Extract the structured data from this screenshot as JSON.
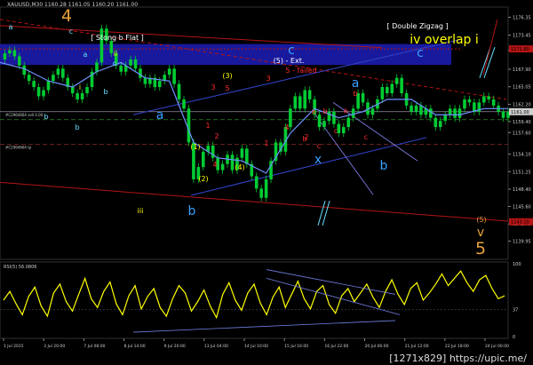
{
  "header": {
    "symbol_line": "XAUUSD,M30  1160.28 1161.05 1160.20 1161.00"
  },
  "watermark": "[1271x829] https://upic.me/",
  "colors": {
    "background": "#000000",
    "candle": "#00cc33",
    "ma_line": "#6f93ff",
    "channel": "#3040c0",
    "red_line": "#b41414",
    "blue_box": "#1a1aa5",
    "price_line": "#9090a0",
    "rsi_line": "#ffff00",
    "wave_orange": "#e8a23a",
    "wave_yellow": "#ffff00",
    "wave_red": "#ff2a2a",
    "wave_blue": "#3aa0ff",
    "wave_cyan": "#66e0ff",
    "white_text": "#ffffff"
  },
  "chart_data": {
    "type": "line",
    "title": "XAUUSD,M30",
    "ylim": [
      1137,
      1178
    ],
    "y_ticks": [
      "1176.35",
      "1173.45",
      "1171.00",
      "1167.90",
      "1165.05",
      "1162.20",
      "1159.40",
      "1157.60",
      "1154.10",
      "1151.25",
      "1148.40",
      "1145.60",
      "1142.75",
      "1139.95"
    ],
    "price_now": "1161.00",
    "price_tags": [
      {
        "text": "1161.00",
        "price": 1161.0,
        "color": "#cfcfcf"
      },
      {
        "text": "1171.80",
        "price": 1171.2,
        "color": "#b41414"
      },
      {
        "text": "1143.10",
        "price": 1143.1,
        "color": "#b41414"
      }
    ],
    "x_tick_labels": [
      "1 Jul 2015",
      "3 Jul 20:00",
      "7 Jul 08:00",
      "8 Jul 14:00",
      "9 Jul 20:00",
      "13 Jul 04:00",
      "14 Jul 10:00",
      "15 Jul 16:00",
      "16 Jul 22:00",
      "20 Jul 06:00",
      "21 Jul 12:00",
      "22 Jul 18:00",
      "24 Jul 00:00"
    ],
    "series": [
      {
        "name": "price",
        "x": [
          0,
          4,
          8,
          12,
          16,
          20,
          24,
          28,
          32,
          36,
          40,
          44,
          48,
          52,
          56,
          60,
          64,
          68,
          72,
          76,
          80,
          84,
          88,
          92,
          96,
          100,
          104,
          108,
          112,
          116,
          120,
          124,
          128,
          132,
          136,
          140,
          144,
          148,
          152,
          156,
          160,
          164,
          168,
          172,
          176,
          180,
          184,
          188,
          192,
          196,
          200,
          204,
          208,
          212,
          216,
          220,
          224,
          228,
          232,
          236,
          240,
          244,
          248,
          252,
          256,
          260,
          264,
          268,
          272,
          276,
          280,
          284,
          288,
          292,
          296,
          300,
          304,
          308,
          312,
          316,
          320,
          324,
          328,
          332,
          336,
          340,
          344,
          348,
          352,
          356,
          360,
          364,
          368,
          372,
          376,
          380,
          384,
          388,
          392,
          396,
          400,
          404,
          408,
          412,
          416,
          420
        ],
        "values": [
          1169.5,
          1170.5,
          1171.0,
          1170.0,
          1168.5,
          1167.0,
          1166.0,
          1165.0,
          1163.5,
          1164.5,
          1166.0,
          1167.0,
          1168.0,
          1166.5,
          1165.0,
          1164.0,
          1163.0,
          1164.0,
          1165.0,
          1167.5,
          1169.0,
          1174.5,
          1172.5,
          1170.5,
          1168.5,
          1167.5,
          1168.5,
          1169.5,
          1168.0,
          1166.5,
          1165.5,
          1166.5,
          1165.0,
          1166.0,
          1167.0,
          1168.0,
          1165.5,
          1163.0,
          1161.5,
          1156.0,
          1150.0,
          1152.0,
          1154.5,
          1155.5,
          1153.5,
          1151.5,
          1152.5,
          1154.0,
          1151.5,
          1153.5,
          1155.0,
          1152.5,
          1150.5,
          1148.5,
          1147.0,
          1150.0,
          1153.0,
          1156.0,
          1154.5,
          1158.5,
          1161.5,
          1163.5,
          1161.5,
          1164.5,
          1163.0,
          1160.5,
          1158.5,
          1159.5,
          1161.0,
          1159.0,
          1157.5,
          1158.5,
          1160.0,
          1161.5,
          1164.0,
          1162.5,
          1160.5,
          1161.5,
          1163.0,
          1165.0,
          1164.0,
          1165.5,
          1166.5,
          1164.0,
          1162.0,
          1161.0,
          1162.0,
          1160.5,
          1161.5,
          1160.0,
          1158.5,
          1159.5,
          1160.5,
          1161.5,
          1160.0,
          1161.5,
          1163.0,
          1162.5,
          1161.0,
          1162.5,
          1163.5,
          1163.0,
          1162.0,
          1161.0,
          1160.0,
          1161.0
        ]
      },
      {
        "name": "ma",
        "x": [
          0,
          20,
          40,
          60,
          80,
          100,
          120,
          140,
          160,
          180,
          200,
          220,
          240,
          260,
          280,
          300,
          320,
          340,
          360,
          380,
          400,
          420
        ],
        "values": [
          1169.0,
          1168.0,
          1166.0,
          1165.0,
          1167.5,
          1169.0,
          1166.5,
          1166.0,
          1156.0,
          1153.5,
          1153.0,
          1151.0,
          1157.5,
          1161.5,
          1160.0,
          1161.0,
          1163.0,
          1163.0,
          1160.5,
          1160.5,
          1161.5,
          1161.5
        ]
      }
    ],
    "rsi": {
      "label": "RSI(5) 56.0806",
      "tick_labels": [
        "100",
        "37",
        "0"
      ],
      "values": [
        50,
        62,
        45,
        30,
        55,
        68,
        42,
        28,
        60,
        72,
        48,
        35,
        58,
        80,
        52,
        40,
        62,
        75,
        45,
        30,
        56,
        70,
        38,
        55,
        66,
        40,
        28,
        52,
        70,
        60,
        35,
        48,
        64,
        42,
        26,
        58,
        74,
        50,
        36,
        60,
        72,
        46,
        30,
        54,
        68,
        40,
        58,
        76,
        52,
        38,
        62,
        70,
        44,
        32,
        56,
        66,
        48,
        60,
        72,
        54,
        40,
        62,
        78,
        58,
        44,
        66,
        74,
        50,
        60,
        72,
        86,
        70,
        80,
        90,
        74,
        62,
        78,
        84,
        66,
        52,
        56
      ]
    },
    "annotations": [
      {
        "text": "4",
        "color": "orange",
        "size": "large"
      },
      {
        "text": "a",
        "color": "cyan"
      },
      {
        "text": "c",
        "color": "cyan"
      },
      {
        "text": "ii",
        "color": "yellow"
      },
      {
        "text": "a",
        "color": "cyan"
      },
      {
        "text": "c",
        "color": "cyan"
      },
      {
        "text": "i",
        "color": "yellow"
      },
      {
        "text": "b",
        "color": "cyan"
      },
      {
        "text": "b",
        "color": "cyan"
      },
      {
        "text": "b",
        "color": "cyan"
      },
      {
        "text": "[ Stong b Flat ]",
        "color": "white"
      },
      {
        "text": "a",
        "color": "blue",
        "size": "medium"
      },
      {
        "text": "iii",
        "color": "yellow"
      },
      {
        "text": "b",
        "color": "blue",
        "size": "medium"
      },
      {
        "text": "(1)",
        "color": "yellow"
      },
      {
        "text": "(2)",
        "color": "yellow"
      },
      {
        "text": "(3)",
        "color": "yellow"
      },
      {
        "text": "(4)",
        "color": "yellow"
      },
      {
        "text": "(5) - Ext.",
        "color": "white"
      },
      {
        "text": "5 - failed",
        "color": "red"
      },
      {
        "text": "1",
        "color": "red"
      },
      {
        "text": "2",
        "color": "red"
      },
      {
        "text": "3",
        "color": "red"
      },
      {
        "text": "4",
        "color": "red"
      },
      {
        "text": "5",
        "color": "red"
      },
      {
        "text": "1",
        "color": "red"
      },
      {
        "text": "2",
        "color": "red"
      },
      {
        "text": "3",
        "color": "red"
      },
      {
        "text": "4",
        "color": "red"
      },
      {
        "text": "c",
        "color": "blue",
        "size": "medium"
      },
      {
        "text": "a",
        "color": "red"
      },
      {
        "text": "b",
        "color": "red"
      },
      {
        "text": "c",
        "color": "red"
      },
      {
        "text": "c",
        "color": "red"
      },
      {
        "text": "b",
        "color": "red"
      },
      {
        "text": "a",
        "color": "red"
      },
      {
        "text": "b",
        "color": "red"
      },
      {
        "text": "c",
        "color": "red"
      },
      {
        "text": "a",
        "color": "blue",
        "size": "medium"
      },
      {
        "text": "x",
        "color": "blue",
        "size": "medium"
      },
      {
        "text": "b",
        "color": "blue",
        "size": "medium"
      },
      {
        "text": "[ Double Zigzag ]",
        "color": "white"
      },
      {
        "text": "iv overlap i",
        "color": "yellow",
        "size": "medium"
      },
      {
        "text": "c",
        "color": "blue",
        "size": "medium"
      },
      {
        "text": "(5)",
        "color": "orange"
      },
      {
        "text": "v",
        "color": "orange",
        "size": "medium"
      },
      {
        "text": "5",
        "color": "orange",
        "size": "large"
      }
    ],
    "indicator_labels": [
      "#C2964664 sell 0.00",
      "#C2964664 tp"
    ]
  }
}
